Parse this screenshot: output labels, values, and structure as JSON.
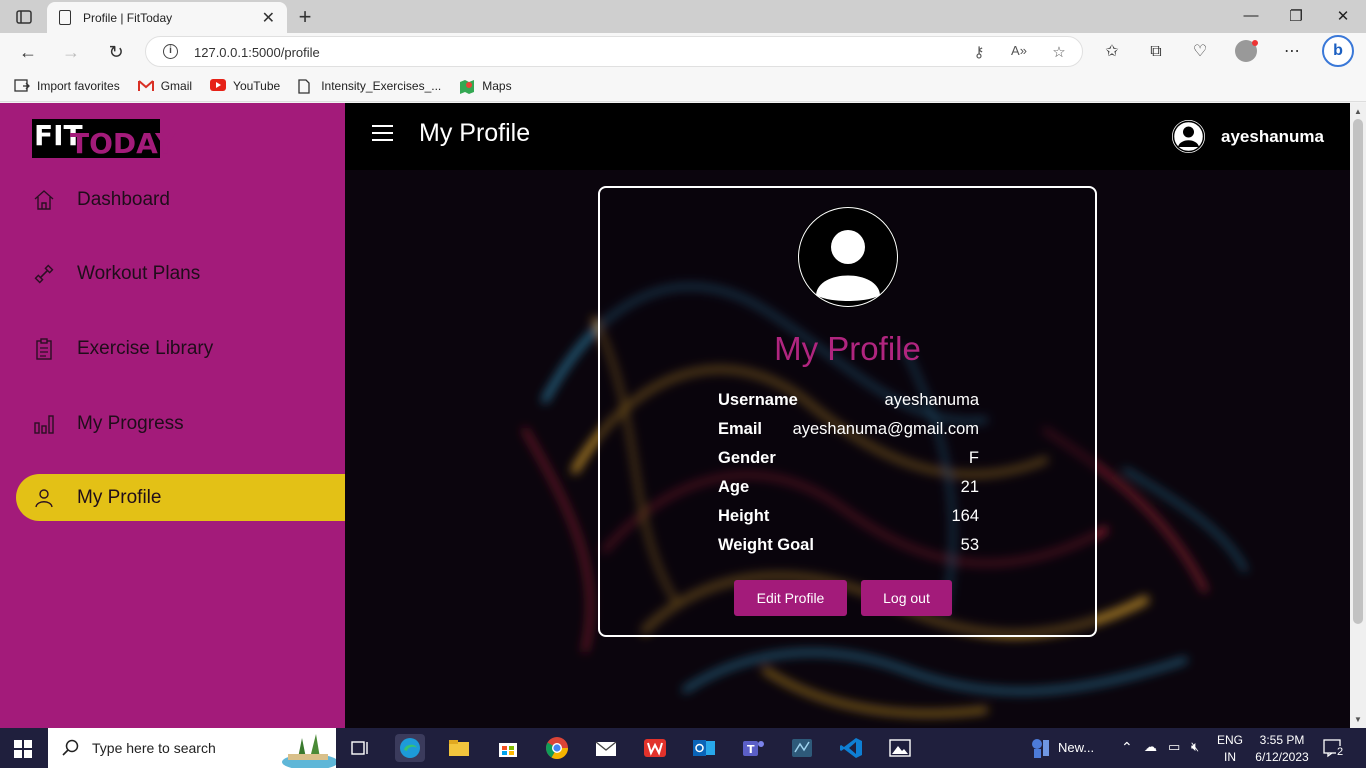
{
  "browser": {
    "tab_title": "Profile | FitToday",
    "url": "127.0.0.1:5000/profile",
    "favorites": [
      "Import favorites",
      "Gmail",
      "YouTube",
      "Intensity_Exercises_...",
      "Maps"
    ]
  },
  "sidebar": {
    "logo_fit": "FIT",
    "logo_today": "TODAY",
    "items": [
      {
        "label": "Dashboard",
        "icon": "home-icon"
      },
      {
        "label": "Workout Plans",
        "icon": "dumbbell-icon"
      },
      {
        "label": "Exercise Library",
        "icon": "clipboard-icon"
      },
      {
        "label": "My Progress",
        "icon": "bar-chart-icon"
      },
      {
        "label": "My Profile",
        "icon": "user-icon",
        "active": true
      }
    ]
  },
  "header": {
    "title": "My Profile",
    "username": "ayeshanuma"
  },
  "profile": {
    "title": "My Profile",
    "fields": [
      {
        "label": "Username",
        "value": "ayeshanuma"
      },
      {
        "label": "Email",
        "value": "ayeshanuma@gmail.com"
      },
      {
        "label": "Gender",
        "value": "F"
      },
      {
        "label": "Age",
        "value": "21"
      },
      {
        "label": "Height",
        "value": "164"
      },
      {
        "label": "Weight Goal",
        "value": "53"
      }
    ],
    "edit_button": "Edit Profile",
    "logout_button": "Log out"
  },
  "taskbar": {
    "search_placeholder": "Type here to search",
    "weather_label": "New...",
    "lang_line1": "ENG",
    "lang_line2": "IN",
    "time": "3:55 PM",
    "date": "6/12/2023",
    "notification_count": "2"
  },
  "colors": {
    "accent": "#a31b7a",
    "active_nav": "#e3c116",
    "main_bg": "#0b050d"
  }
}
